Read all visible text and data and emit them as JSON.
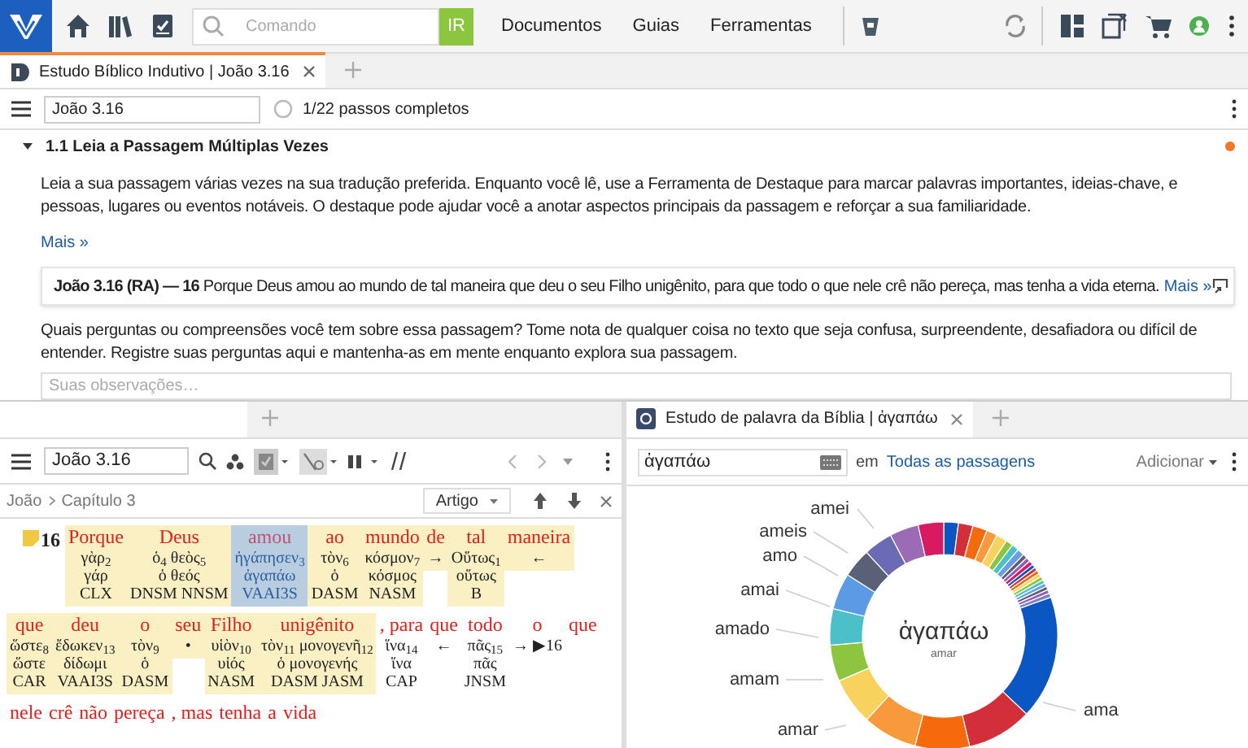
{
  "top_bar": {
    "search_placeholder": "Comando",
    "go_button": "IR",
    "menu": [
      "Documentos",
      "Guias",
      "Ferramentas"
    ]
  },
  "document_tab": {
    "title": "Estudo Bíblico Indutivo | João 3.16",
    "selected": true
  },
  "toolbar": {
    "reference": "João 3.16",
    "progress": "1/22 passos completos"
  },
  "step": {
    "title": "1.1 Leia a Passagem Múltiplas Vezes",
    "expanded": true,
    "instructions": "Leia a sua passagem várias vezes na sua tradução preferida. Enquanto você lê, use a Ferramenta de Destaque para marcar palavras importantes, ideias-chave, e pessoas, lugares ou eventos notáveis. O destaque pode ajudar você a anotar aspectos principais da passagem e reforçar a sua familiaridade.",
    "more_link": "Mais »",
    "passage": {
      "reference": "João 3.16 (RA) — 16",
      "text": "Porque Deus amou ao mundo de tal maneira que deu o seu Filho unigênito, para que todo o que nele crê não pereça, mas tenha a vida eterna.",
      "more_link": "Mais »"
    },
    "question": "Quais perguntas ou compreensões você tem sobre essa passagem? Tome nota de qualquer coisa no texto que seja confusa, surpreendente, desafiadora ou difícil de entender. Registre suas perguntas aqui e mantenha-as em mente enquanto explora sua passagem.",
    "notes_placeholder": "Suas observações…"
  },
  "interlinear_panel": {
    "reference": "João 3.16",
    "breadcrumb": [
      "João",
      "Capítulo 3"
    ],
    "view_button": "Artigo",
    "verse_number": "16",
    "lines": [
      {
        "words": [
          {
            "english": "Porque",
            "greek": "γὰρ$_{2}$",
            "lemma": "γάρ",
            "morph": "CLX",
            "highlighted": true,
            "selected": false
          },
          {
            "english": "Deus",
            "greek": "ὁ$_{4}$ θεὸς$_{5}$",
            "lemma": "ὁ θεός",
            "morph": "DNSM NNSM",
            "highlighted": true,
            "selected": false
          },
          {
            "english": "amou",
            "greek": "ἠγάπησεν$_{3}$",
            "lemma": "ἀγαπάω",
            "morph": "VAAI3S",
            "highlighted": true,
            "selected": true
          },
          {
            "english": "ao",
            "greek": "τὸν$_{6}$",
            "lemma": "ὁ",
            "morph": "DASM",
            "highlighted": true,
            "selected": false
          },
          {
            "english": "mundo",
            "greek": "κόσμον$_{7}$",
            "lemma": "κόσμος",
            "morph": "NASM",
            "highlighted": true,
            "selected": false
          },
          {
            "english": "de",
            "greek": "→",
            "highlighted": true,
            "selected": false
          },
          {
            "english": "tal",
            "greek": "Οὕτως$_{1}$",
            "lemma": "οὕτως",
            "morph": "B",
            "highlighted": true,
            "selected": false
          },
          {
            "english": "maneira",
            "greek": "←",
            "highlighted": true,
            "selected": false
          }
        ]
      },
      {
        "words": [
          {
            "english": "que",
            "greek": "ὥστε$_{8}$",
            "lemma": "ὥστε",
            "morph": "CAR",
            "highlighted": true,
            "selected": false
          },
          {
            "english": "deu",
            "greek": "ἔδωκεν$_{13}$",
            "lemma": "δίδωμι",
            "morph": "VAAI3S",
            "highlighted": true,
            "selected": false
          },
          {
            "english": "o",
            "greek": "τὸν$_{9}$",
            "lemma": "ὁ",
            "morph": "DASM",
            "highlighted": true,
            "selected": false
          },
          {
            "english": "seu",
            "greek": "•",
            "highlighted": true,
            "selected": false
          },
          {
            "english": "Filho",
            "greek": "υἱὸν$_{10}$",
            "lemma": "υἱός",
            "morph": "NASM",
            "highlighted": true,
            "selected": false
          },
          {
            "english": "unigênito",
            "greek": "τὸν$_{11}$ μονογενῆ$_{12}$",
            "lemma": "ὁ μονογενής",
            "morph": "DASM JASM",
            "highlighted": true,
            "selected": false
          },
          {
            "english": ", para",
            "greek": "ἵνα$_{14}$",
            "lemma": "ἵνα",
            "morph": "CAP",
            "highlighted": false,
            "selected": false
          },
          {
            "english": "que",
            "greek": "←",
            "highlighted": false,
            "selected": false
          },
          {
            "english": "todo",
            "greek": "πᾶς$_{15}$",
            "lemma": "πᾶς",
            "morph": "JNSM",
            "highlighted": false,
            "selected": false
          },
          {
            "english": "o",
            "greek": "→ ▶16",
            "highlighted": false,
            "selected": false
          },
          {
            "english": "que",
            "highlighted": false,
            "selected": false
          }
        ]
      },
      {
        "words": [
          {
            "english": "nele",
            "highlighted": false,
            "selected": false
          },
          {
            "english": "crê",
            "highlighted": false,
            "selected": false
          },
          {
            "english": "não",
            "highlighted": false,
            "selected": false
          },
          {
            "english": "pereça",
            "highlighted": false,
            "selected": false
          },
          {
            "english": ", mas",
            "highlighted": false,
            "selected": false
          },
          {
            "english": "tenha",
            "highlighted": false,
            "selected": false
          },
          {
            "english": "a",
            "highlighted": false,
            "selected": false
          },
          {
            "english": "vida",
            "highlighted": false,
            "selected": false
          }
        ]
      }
    ]
  },
  "word_study_panel": {
    "tab_title": "Estudo de palavra da Bíblia | ἀγαπάω",
    "query": "ἀγαπάω",
    "scope_prefix": "em",
    "scope_link": "Todas as passagens",
    "add_button": "Adicionar",
    "chart_center": "ἀγαπάω",
    "chart_subtitle": "amar",
    "slice_labels": [
      "amei",
      "ameis",
      "amo",
      "amai",
      "amado",
      "amam",
      "amar",
      "ama"
    ]
  }
}
